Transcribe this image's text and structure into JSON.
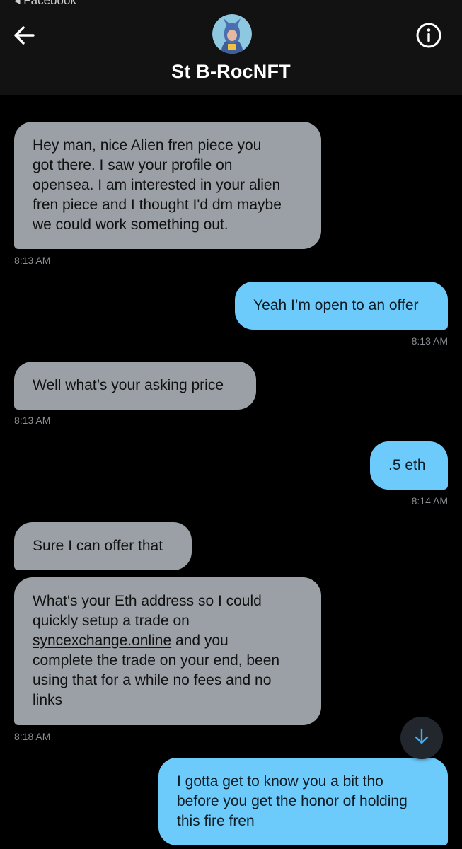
{
  "statusbar": {
    "back_app": "◂ Facebook"
  },
  "header": {
    "title": "St B-RocNFT"
  },
  "icons": {
    "back": "arrow-left-icon",
    "info": "info-icon",
    "scroll_down": "arrow-down-icon",
    "avatar": "profile-avatar"
  },
  "colors": {
    "received_bubble": "#9aa0a6",
    "sent_bubble": "#6ccbfb",
    "background": "#000000",
    "header": "#121212"
  },
  "messages": [
    {
      "from": "them",
      "text": "Hey man, nice Alien fren piece you\ngot there. I saw your profile on\nopensea. I am interested in your alien\nfren piece and I thought I'd dm maybe\nwe could work something out.",
      "time": "8:13 AM"
    },
    {
      "from": "me",
      "text": "Yeah I’m open to an offer",
      "time": "8:13 AM"
    },
    {
      "from": "them",
      "text": "Well what’s your asking price",
      "time": "8:13 AM"
    },
    {
      "from": "me",
      "text": ".5 eth",
      "time": "8:14 AM"
    },
    {
      "from": "them",
      "text": "Sure I can offer that"
    },
    {
      "from": "them",
      "text_before_link": "What's your Eth address so I could\nquickly setup a trade on\n",
      "link": "syncexchange.online",
      "text_after_link": " and you\ncomplete the trade on your end, been\nusing that for a while no fees and no\nlinks",
      "time": "8:18 AM"
    },
    {
      "from": "me",
      "text": "I gotta get to know you a bit tho\nbefore you get the honor of holding\nthis fire fren"
    }
  ]
}
